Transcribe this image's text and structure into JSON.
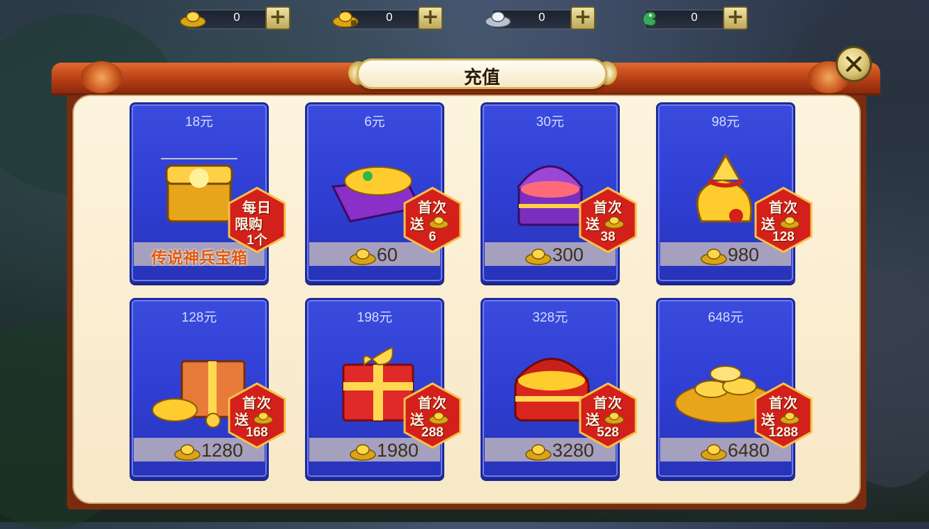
{
  "currencies": [
    {
      "icon": "gold-ingot-icon",
      "value": "0",
      "plus": "+"
    },
    {
      "icon": "bound-gold-ingot-icon",
      "value": "0",
      "plus": "+"
    },
    {
      "icon": "silver-ingot-icon",
      "value": "0",
      "plus": "+"
    },
    {
      "icon": "jade-dragon-icon",
      "value": "0",
      "plus": "+"
    }
  ],
  "dialog": {
    "title": "充值",
    "close_icon": "close-icon"
  },
  "cards": [
    {
      "price": "18元",
      "name": "传说神兵宝箱",
      "badge": [
        "每日",
        "限购",
        "1个"
      ],
      "art": "golden-treasure-chest"
    },
    {
      "price": "6元",
      "amount": "60",
      "badge": [
        "首次",
        "送",
        "6"
      ],
      "art": "purple-treasure-box"
    },
    {
      "price": "30元",
      "amount": "300",
      "badge": [
        "首次",
        "送",
        "38"
      ],
      "art": "purple-gem-chest"
    },
    {
      "price": "98元",
      "amount": "980",
      "badge": [
        "首次",
        "送",
        "128"
      ],
      "art": "red-gold-bag"
    },
    {
      "price": "128元",
      "amount": "1280",
      "badge": [
        "首次",
        "送",
        "168"
      ],
      "art": "gift-pile"
    },
    {
      "price": "198元",
      "amount": "1980",
      "badge": [
        "首次",
        "送",
        "288"
      ],
      "art": "red-gift-box"
    },
    {
      "price": "328元",
      "amount": "3280",
      "badge": [
        "首次",
        "送",
        "528"
      ],
      "art": "red-gold-chest"
    },
    {
      "price": "648元",
      "amount": "6480",
      "badge": [
        "首次",
        "送",
        "1288"
      ],
      "art": "gold-ingot-pile"
    }
  ],
  "colors": {
    "card_blue": "#2f3fd4",
    "badge_red": "#d3201a",
    "panel_cream": "#fdf4de",
    "frame_orange": "#c8521c"
  }
}
